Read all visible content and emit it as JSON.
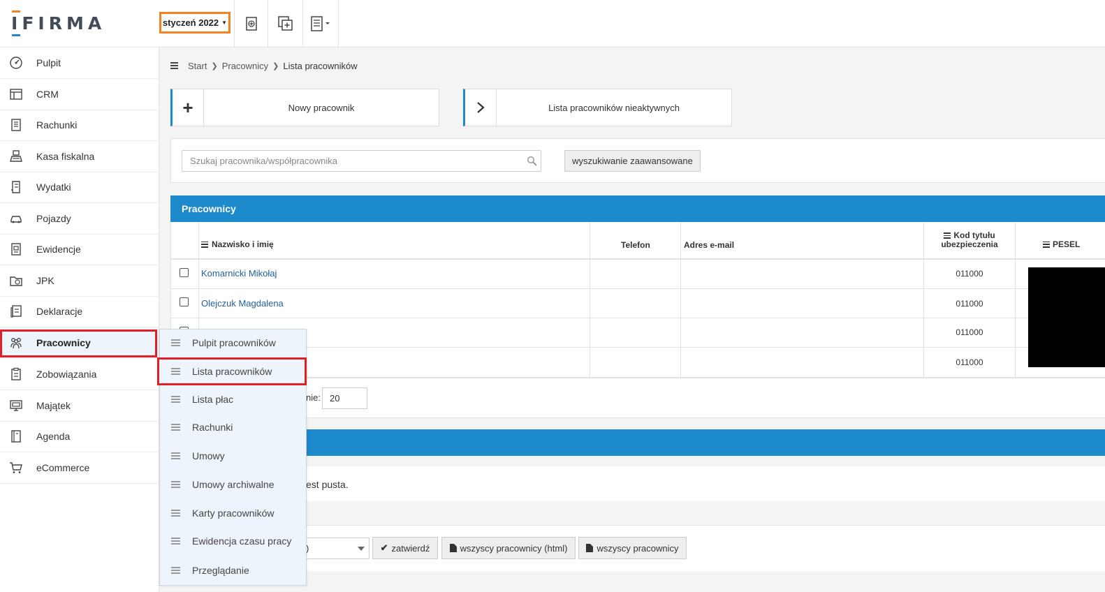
{
  "header": {
    "logo_text": "IFIRMA",
    "month_label": "styczeń 2022",
    "icons": [
      "receipt-add-icon",
      "copy-add-icon",
      "document-list-icon"
    ]
  },
  "sidebar": {
    "items": [
      {
        "label": "Pulpit",
        "icon": "dashboard-icon"
      },
      {
        "label": "CRM",
        "icon": "crm-icon"
      },
      {
        "label": "Rachunki",
        "icon": "receipt-icon"
      },
      {
        "label": "Kasa fiskalna",
        "icon": "cash-register-icon"
      },
      {
        "label": "Wydatki",
        "icon": "expenses-icon"
      },
      {
        "label": "Pojazdy",
        "icon": "car-icon"
      },
      {
        "label": "Ewidencje",
        "icon": "records-icon"
      },
      {
        "label": "JPK",
        "icon": "jpk-icon"
      },
      {
        "label": "Deklaracje",
        "icon": "declarations-icon"
      },
      {
        "label": "Pracownicy",
        "icon": "employees-icon"
      },
      {
        "label": "Zobowiązania",
        "icon": "liabilities-icon"
      },
      {
        "label": "Majątek",
        "icon": "assets-icon"
      },
      {
        "label": "Agenda",
        "icon": "agenda-icon"
      },
      {
        "label": "eCommerce",
        "icon": "cart-icon"
      }
    ],
    "active_index": 9
  },
  "submenu": {
    "items": [
      "Pulpit pracowników",
      "Lista pracowników",
      "Lista płac",
      "Rachunki",
      "Umowy",
      "Umowy archiwalne",
      "Karty pracowników",
      "Ewidencja czasu pracy",
      "Przeglądanie"
    ],
    "selected_index": 1
  },
  "breadcrumb": {
    "items": [
      "Start",
      "Pracownicy",
      "Lista pracowników"
    ]
  },
  "actions": {
    "new_employee": "Nowy pracownik",
    "inactive_list": "Lista pracowników nieaktywnych"
  },
  "search": {
    "placeholder": "Szukaj pracownika/współpracownika",
    "advanced_label": "wyszukiwanie zaawansowane"
  },
  "employees_panel": {
    "title": "Pracownicy",
    "columns": {
      "name": "Nazwisko i imię",
      "phone": "Telefon",
      "email": "Adres e-mail",
      "insurance_line1": "Kod tytułu",
      "insurance_line2": "ubezpieczenia",
      "pesel": "PESEL"
    },
    "rows": [
      {
        "name": "Komarnicki Mikołaj",
        "phone": "",
        "email": "",
        "insurance": "011000"
      },
      {
        "name": "Olejczuk Magdalena",
        "phone": "",
        "email": "",
        "insurance": "011000"
      },
      {
        "name": "",
        "phone": "",
        "email": "",
        "insurance": "011000"
      },
      {
        "name": "",
        "phone": "",
        "email": "",
        "insurance": "011000"
      }
    ]
  },
  "pager": {
    "label_fragment": "nie:",
    "per_page": "20"
  },
  "second_panel": {
    "empty_fragment": "est pusta."
  },
  "bottom": {
    "select_fragment": ")",
    "confirm_label": "zatwierdź",
    "all_html_label": "wszyscy pracownicy (html)",
    "all_label": "wszyscy pracownicy"
  },
  "colors": {
    "accent_blue": "#1d8acb",
    "highlight_orange": "#f58220",
    "highlight_red": "#e31e24"
  }
}
